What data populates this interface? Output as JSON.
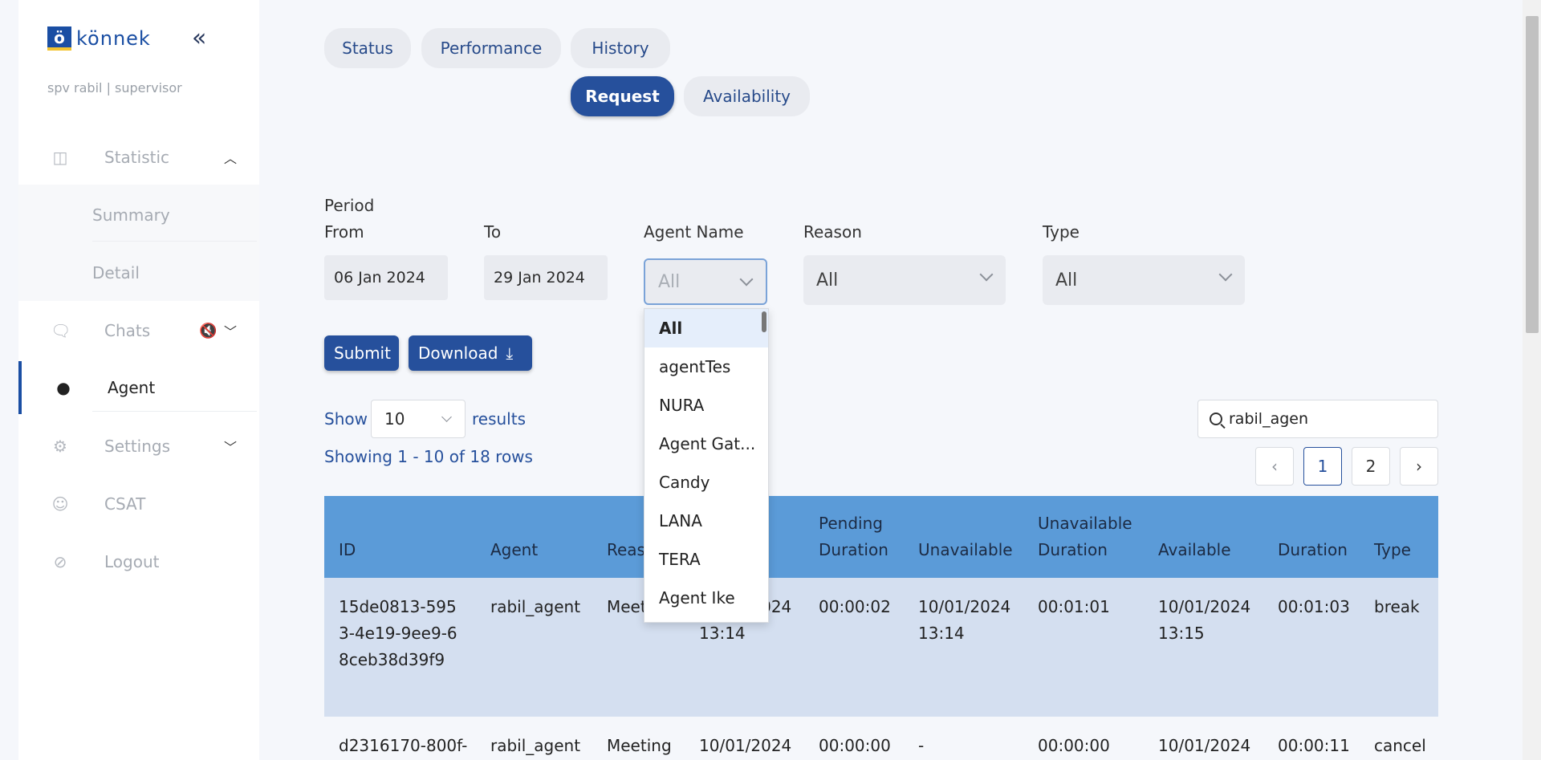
{
  "brand": {
    "logo_mark": "ö",
    "logo_text": "könnek"
  },
  "user": {
    "line": "spv rabil | supervisor"
  },
  "sidebar": {
    "items": [
      {
        "label": "Statistic",
        "icon": "columns-icon"
      },
      {
        "label": "Chats",
        "icon": "chat-bubbles-icon"
      },
      {
        "label": "Agent",
        "icon": "person-icon"
      },
      {
        "label": "Settings",
        "icon": "gear-icon"
      },
      {
        "label": "CSAT",
        "icon": "smiley-icon"
      },
      {
        "label": "Logout",
        "icon": "logout-icon"
      }
    ],
    "submenu": [
      "Summary",
      "Detail"
    ]
  },
  "tabs": {
    "status": "Status",
    "performance": "Performance",
    "history": "History",
    "request": "Request",
    "availability": "Availability"
  },
  "filters": {
    "period_label": "Period",
    "from_label": "From",
    "to_label": "To",
    "agent_label": "Agent Name",
    "reason_label": "Reason",
    "type_label": "Type",
    "from_value": "06 Jan 2024",
    "to_value": "29 Jan 2024",
    "agent_value": "All",
    "reason_value": "All",
    "type_value": "All"
  },
  "actions": {
    "submit": "Submit",
    "download": "Download"
  },
  "listing": {
    "show": "Show",
    "page_size": "10",
    "results": "results",
    "showing": "Showing 1 - 10 of 18 rows",
    "search_value": "rabil_agen",
    "pages": [
      "1",
      "2"
    ]
  },
  "table": {
    "headers": {
      "id": "ID",
      "agent": "Agent",
      "reason": "Reason",
      "pending_duration": "Pending Duration",
      "unavailable": "Unavailable",
      "unavailable_duration": "Unavailable Duration",
      "available": "Available",
      "duration": "Duration",
      "type": "Type"
    },
    "rows": [
      {
        "id": "15de0813-5953-4e19-9ee9-68ceb38d39f9",
        "agent": "rabil_agent",
        "reason": "Meeting",
        "requested": "10/01/2024 13:14",
        "pending_duration": "00:00:02",
        "unavailable": "10/01/2024 13:14",
        "unavailable_duration": "00:01:01",
        "available": "10/01/2024 13:15",
        "duration": "00:01:03",
        "type": "break"
      },
      {
        "id": "d2316170-800f-",
        "agent": "rabil_agent",
        "reason": "Meeting",
        "requested": "10/01/2024",
        "pending_duration": "00:00:00",
        "unavailable": "-",
        "unavailable_duration": "00:00:00",
        "available": "10/01/2024",
        "duration": "00:00:11",
        "type": "cancel"
      }
    ]
  },
  "agent_dropdown": {
    "options": [
      "All",
      "agentTes",
      "NURA",
      "Agent Gat...",
      "Candy",
      "LANA",
      "TERA",
      "Agent Ike"
    ]
  }
}
